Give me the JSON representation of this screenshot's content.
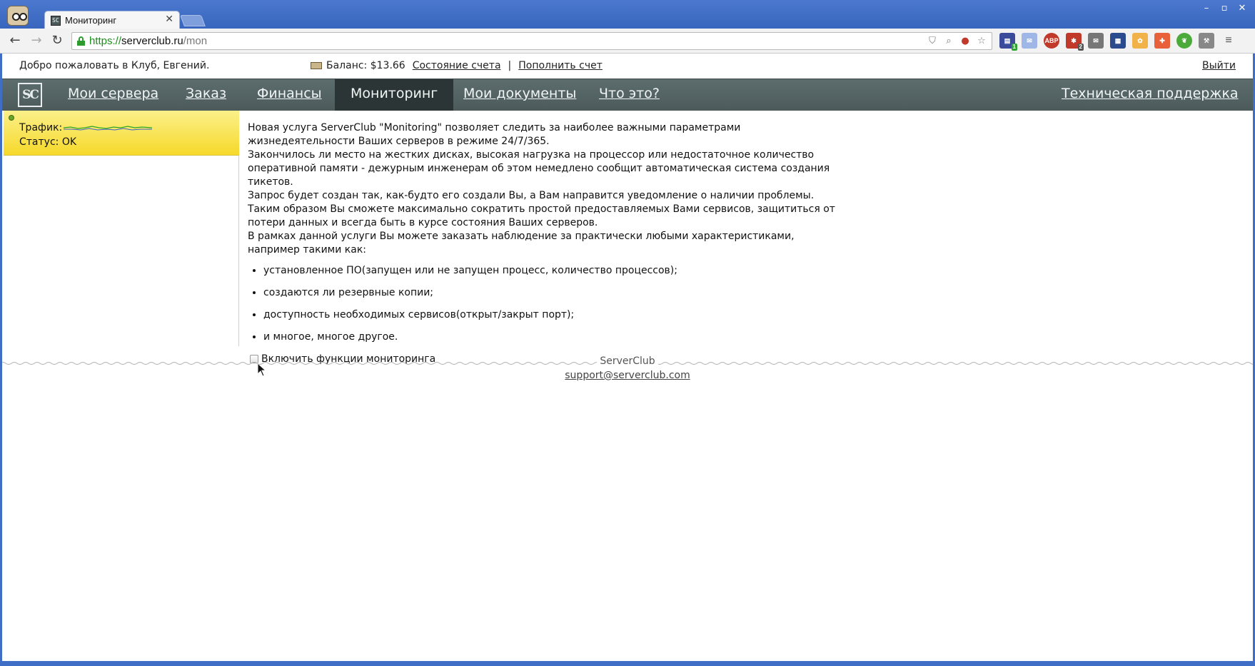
{
  "browser": {
    "tab_title": "Мониторинг",
    "tab_favicon": "SC",
    "url_scheme": "https://",
    "url_host": "serverclub.ru",
    "url_path": "/mon",
    "extension_badges": [
      "1",
      "2"
    ]
  },
  "account_bar": {
    "welcome": "Добро пожаловать в Клуб, Евгений.",
    "balance": "Баланс: $13.66",
    "account_status_link": "Состояние счета",
    "separator": "|",
    "top_up_link": "Пополнить счет",
    "logout": "Выйти"
  },
  "nav": {
    "logo": "SC",
    "items": [
      {
        "label": "Мои сервера"
      },
      {
        "label": "Заказ"
      },
      {
        "label": "Финансы"
      },
      {
        "label": "Мониторинг",
        "active": true
      },
      {
        "label": "Мои документы"
      },
      {
        "label": "Что это?"
      }
    ],
    "support": "Техническая поддержка"
  },
  "sidebar": {
    "traffic_label": "Трафик:",
    "status_label": "Статус: OK"
  },
  "content": {
    "paragraphs": [
      "Новая услуга ServerClub \"Monitoring\" позволяет следить за наиболее важными параметрами жизнедеятельности Ваших серверов в режиме 24/7/365.",
      "Закончилось ли место на жестких дисках, высокая нагрузка на процессор или недостаточное количество оперативной памяти - дежурным инженерам об этом немедлено сообщит автоматическая система создания тикетов.",
      "Запрос будет создан так, как-будто его создали Вы, а Вам направится уведомление о наличии проблемы.",
      "Таким образом Вы сможете максимально сократить простой предоставляемых Вами сервисов, защититься от потери данных и всегда быть в курсе состояния Ваших серверов.",
      "В рамках данной услуги Вы можете заказать наблюдение за практически любыми характеристиками, например такими как:"
    ],
    "list": [
      "установленное ПО(запущен или не запущен процесс, количество процессов);",
      "создаются ли резервные копии;",
      "доступность необходимых сервисов(открыт/закрыт порт);",
      "и многое, многое другое."
    ],
    "checkbox_label": "Включить функции мониторинга",
    "checkbox_checked": false
  },
  "footer": {
    "brand": "ServerClub",
    "email": "support@serverclub.com"
  }
}
